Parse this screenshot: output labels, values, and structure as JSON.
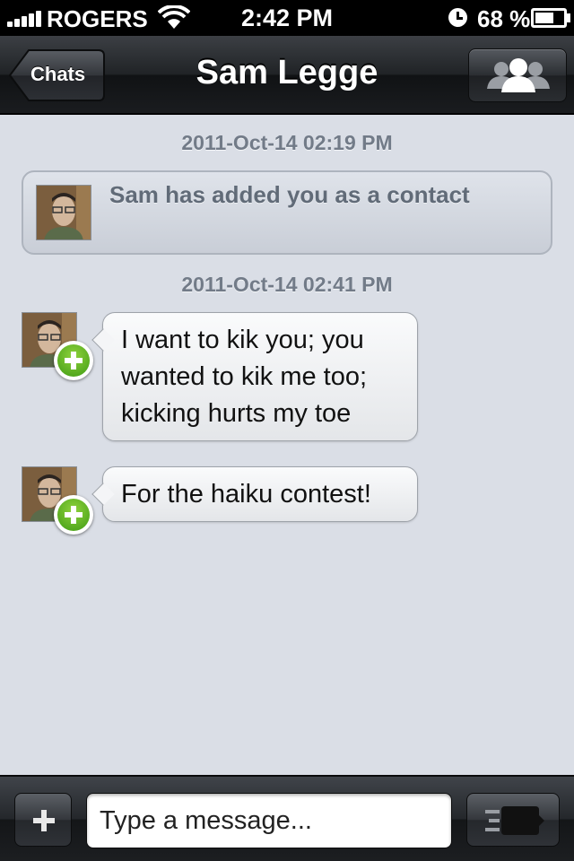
{
  "status_bar": {
    "carrier": "ROGERS",
    "time": "2:42 PM",
    "battery_percent": "68 %",
    "battery_level": 0.68,
    "icons": [
      "signal-icon",
      "wifi-icon",
      "alarm-icon",
      "battery-icon"
    ]
  },
  "nav": {
    "back_label": "Chats",
    "title": "Sam Legge",
    "right_icon": "contacts-icon"
  },
  "chat": {
    "timestamps": [
      "2011-Oct-14 02:19 PM",
      "2011-Oct-14 02:41 PM"
    ],
    "system_message": "Sam has added you as a contact",
    "messages": [
      {
        "lines": [
          "I want to kik you; you",
          "wanted to kik me too;",
          "kicking hurts my toe"
        ]
      },
      {
        "lines": [
          "For the haiku contest!"
        ]
      }
    ]
  },
  "input_bar": {
    "attach_icon": "plus-icon",
    "placeholder": "Type a message...",
    "send_icon": "send-icon"
  },
  "colors": {
    "chat_background": "#dadee6",
    "timestamp_text": "#727b88",
    "system_text": "#616b78",
    "add_badge_green": "#5fb624"
  }
}
